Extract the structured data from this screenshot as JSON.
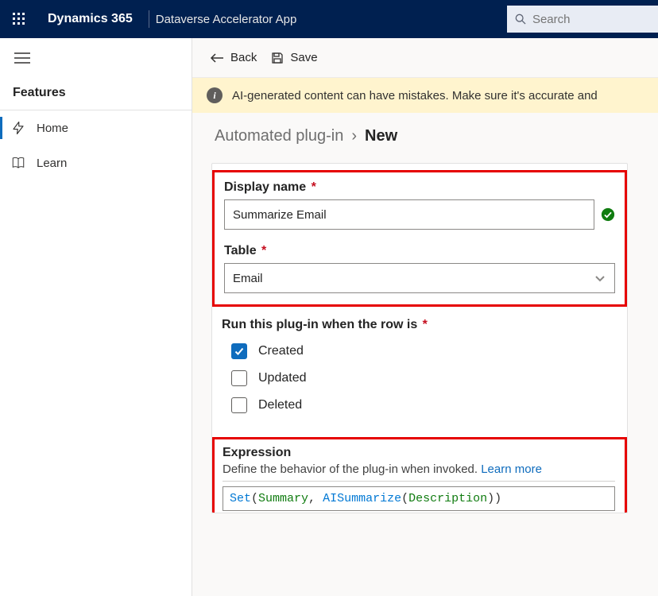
{
  "top": {
    "brand": "Dynamics 365",
    "app_name": "Dataverse Accelerator App",
    "search_placeholder": "Search"
  },
  "sidebar": {
    "section_title": "Features",
    "items": [
      {
        "label": "Home",
        "icon": "lightning-icon",
        "active": true
      },
      {
        "label": "Learn",
        "icon": "book-icon",
        "active": false
      }
    ]
  },
  "cmd": {
    "back": "Back",
    "save": "Save"
  },
  "banner": {
    "text": "AI-generated content can have mistakes. Make sure it's accurate and"
  },
  "breadcrumb": {
    "parent": "Automated plug-in",
    "current": "New"
  },
  "form": {
    "display_name_label": "Display name",
    "display_name_value": "Summarize Email",
    "table_label": "Table",
    "table_value": "Email",
    "run_label": "Run this plug-in when the row is",
    "options": [
      {
        "label": "Created",
        "checked": true
      },
      {
        "label": "Updated",
        "checked": false
      },
      {
        "label": "Deleted",
        "checked": false
      }
    ],
    "expression": {
      "title": "Expression",
      "desc": "Define the behavior of the plug-in when invoked.",
      "learn_more": "Learn more",
      "tokens": {
        "set": "Set",
        "summary": "Summary",
        "aisum": "AISummarize",
        "desc_arg": "Description"
      }
    }
  }
}
